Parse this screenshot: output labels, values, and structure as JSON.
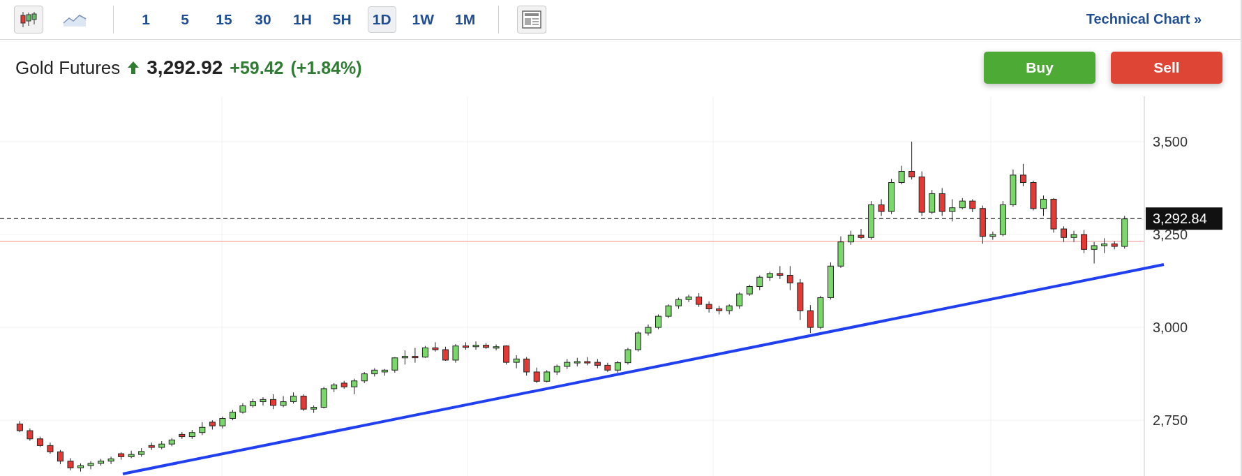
{
  "toolbar": {
    "chart_types": [
      {
        "kind": "candlestick",
        "selected": true
      },
      {
        "kind": "area",
        "selected": false
      }
    ],
    "intervals": [
      {
        "label": "1",
        "selected": false
      },
      {
        "label": "5",
        "selected": false
      },
      {
        "label": "15",
        "selected": false
      },
      {
        "label": "30",
        "selected": false
      },
      {
        "label": "1H",
        "selected": false
      },
      {
        "label": "5H",
        "selected": false
      },
      {
        "label": "1D",
        "selected": true
      },
      {
        "label": "1W",
        "selected": false
      },
      {
        "label": "1M",
        "selected": false
      }
    ],
    "link": {
      "label": "Technical Chart",
      "arrow": "»"
    }
  },
  "quote": {
    "name": "Gold Futures",
    "rising": true,
    "price": "3,292.92",
    "change": "+59.42",
    "change_percent": "(+1.84%)"
  },
  "actions": [
    {
      "kind": "buy",
      "label": "Buy"
    },
    {
      "kind": "sell",
      "label": "Sell"
    }
  ],
  "chart": {
    "last_price": "3,292.84",
    "chart_data": {
      "type": "candlestick",
      "ylim": [
        2600,
        3622
      ],
      "grid": true,
      "ref_lines": [
        {
          "axis": "y",
          "value": 3232,
          "color": "#f4a6a6"
        },
        {
          "axis": "y",
          "value": 3292.84,
          "color": "#222222"
        }
      ],
      "yticks": [
        {
          "value": 3500,
          "label": "3,500"
        },
        {
          "value": 3250,
          "label": "3,250"
        },
        {
          "value": 3000,
          "label": "3,000"
        },
        {
          "value": 2750,
          "label": "2,750"
        }
      ],
      "ohlc": [
        [
          2740,
          2748,
          2718,
          2722
        ],
        [
          2722,
          2728,
          2695,
          2700
        ],
        [
          2700,
          2706,
          2678,
          2682
        ],
        [
          2682,
          2690,
          2660,
          2665
        ],
        [
          2665,
          2670,
          2632,
          2640
        ],
        [
          2640,
          2648,
          2615,
          2622
        ],
        [
          2622,
          2634,
          2612,
          2628
        ],
        [
          2628,
          2640,
          2618,
          2634
        ],
        [
          2634,
          2646,
          2628,
          2640
        ],
        [
          2640,
          2652,
          2632,
          2646
        ],
        [
          2660,
          2664,
          2644,
          2652
        ],
        [
          2652,
          2668,
          2648,
          2658
        ],
        [
          2658,
          2675,
          2652,
          2666
        ],
        [
          2682,
          2690,
          2670,
          2677
        ],
        [
          2677,
          2694,
          2672,
          2686
        ],
        [
          2686,
          2702,
          2680,
          2697
        ],
        [
          2712,
          2718,
          2700,
          2706
        ],
        [
          2706,
          2724,
          2700,
          2717
        ],
        [
          2717,
          2745,
          2710,
          2731
        ],
        [
          2745,
          2750,
          2725,
          2735
        ],
        [
          2735,
          2760,
          2728,
          2755
        ],
        [
          2755,
          2778,
          2750,
          2772
        ],
        [
          2772,
          2796,
          2768,
          2789
        ],
        [
          2789,
          2808,
          2784,
          2800
        ],
        [
          2800,
          2812,
          2790,
          2806
        ],
        [
          2806,
          2820,
          2780,
          2790
        ],
        [
          2790,
          2815,
          2785,
          2800
        ],
        [
          2800,
          2825,
          2795,
          2815
        ],
        [
          2815,
          2820,
          2775,
          2780
        ],
        [
          2780,
          2790,
          2770,
          2785
        ],
        [
          2785,
          2840,
          2782,
          2835
        ],
        [
          2835,
          2850,
          2826,
          2845
        ],
        [
          2850,
          2856,
          2835,
          2840
        ],
        [
          2840,
          2862,
          2820,
          2856
        ],
        [
          2856,
          2880,
          2850,
          2875
        ],
        [
          2875,
          2890,
          2868,
          2885
        ],
        [
          2880,
          2888,
          2870,
          2885
        ],
        [
          2885,
          2920,
          2878,
          2918
        ],
        [
          2918,
          2938,
          2900,
          2922
        ],
        [
          2922,
          2945,
          2905,
          2920
        ],
        [
          2920,
          2950,
          2918,
          2945
        ],
        [
          2945,
          2960,
          2935,
          2940
        ],
        [
          2940,
          2948,
          2910,
          2912
        ],
        [
          2912,
          2955,
          2905,
          2950
        ],
        [
          2950,
          2960,
          2940,
          2948
        ],
        [
          2948,
          2962,
          2940,
          2952
        ],
        [
          2952,
          2958,
          2942,
          2946
        ],
        [
          2946,
          2954,
          2938,
          2948
        ],
        [
          2950,
          2952,
          2900,
          2906
        ],
        [
          2906,
          2925,
          2890,
          2915
        ],
        [
          2915,
          2920,
          2870,
          2880
        ],
        [
          2880,
          2892,
          2850,
          2855
        ],
        [
          2855,
          2885,
          2852,
          2880
        ],
        [
          2880,
          2900,
          2872,
          2895
        ],
        [
          2895,
          2915,
          2888,
          2906
        ],
        [
          2906,
          2918,
          2895,
          2908
        ],
        [
          2908,
          2920,
          2898,
          2906
        ],
        [
          2906,
          2915,
          2890,
          2898
        ],
        [
          2898,
          2905,
          2880,
          2885
        ],
        [
          2885,
          2910,
          2878,
          2905
        ],
        [
          2905,
          2945,
          2900,
          2940
        ],
        [
          2940,
          2990,
          2935,
          2985
        ],
        [
          2985,
          3008,
          2978,
          3000
        ],
        [
          3000,
          3035,
          2995,
          3030
        ],
        [
          3030,
          3062,
          3025,
          3058
        ],
        [
          3058,
          3080,
          3050,
          3075
        ],
        [
          3075,
          3088,
          3068,
          3082
        ],
        [
          3082,
          3092,
          3055,
          3062
        ],
        [
          3062,
          3070,
          3040,
          3050
        ],
        [
          3050,
          3058,
          3035,
          3045
        ],
        [
          3045,
          3062,
          3035,
          3058
        ],
        [
          3058,
          3095,
          3050,
          3090
        ],
        [
          3090,
          3115,
          3085,
          3110
        ],
        [
          3110,
          3140,
          3100,
          3135
        ],
        [
          3135,
          3150,
          3125,
          3145
        ],
        [
          3145,
          3165,
          3130,
          3140
        ],
        [
          3140,
          3165,
          3100,
          3120
        ],
        [
          3120,
          3130,
          3020,
          3045
        ],
        [
          3045,
          3060,
          2985,
          3000
        ],
        [
          3000,
          3085,
          2995,
          3080
        ],
        [
          3080,
          3175,
          3075,
          3165
        ],
        [
          3165,
          3245,
          3160,
          3230
        ],
        [
          3230,
          3260,
          3222,
          3248
        ],
        [
          3248,
          3265,
          3238,
          3242
        ],
        [
          3242,
          3340,
          3236,
          3330
        ],
        [
          3330,
          3345,
          3300,
          3312
        ],
        [
          3312,
          3400,
          3305,
          3390
        ],
        [
          3390,
          3435,
          3385,
          3420
        ],
        [
          3420,
          3500,
          3398,
          3405
        ],
        [
          3405,
          3420,
          3300,
          3310
        ],
        [
          3310,
          3370,
          3305,
          3360
        ],
        [
          3360,
          3375,
          3300,
          3312
        ],
        [
          3312,
          3345,
          3285,
          3322
        ],
        [
          3322,
          3348,
          3318,
          3340
        ],
        [
          3340,
          3345,
          3310,
          3320
        ],
        [
          3320,
          3328,
          3225,
          3245
        ],
        [
          3245,
          3258,
          3236,
          3250
        ],
        [
          3250,
          3340,
          3245,
          3330
        ],
        [
          3330,
          3425,
          3325,
          3410
        ],
        [
          3410,
          3440,
          3380,
          3390
        ],
        [
          3390,
          3395,
          3315,
          3320
        ],
        [
          3320,
          3355,
          3300,
          3345
        ],
        [
          3345,
          3348,
          3255,
          3265
        ],
        [
          3265,
          3272,
          3230,
          3242
        ],
        [
          3242,
          3260,
          3230,
          3250
        ],
        [
          3250,
          3262,
          3200,
          3210
        ],
        [
          3210,
          3230,
          3172,
          3220
        ],
        [
          3220,
          3240,
          3200,
          3225
        ],
        [
          3225,
          3232,
          3210,
          3218
        ],
        [
          3218,
          3300,
          3212,
          3292
        ]
      ]
    }
  }
}
